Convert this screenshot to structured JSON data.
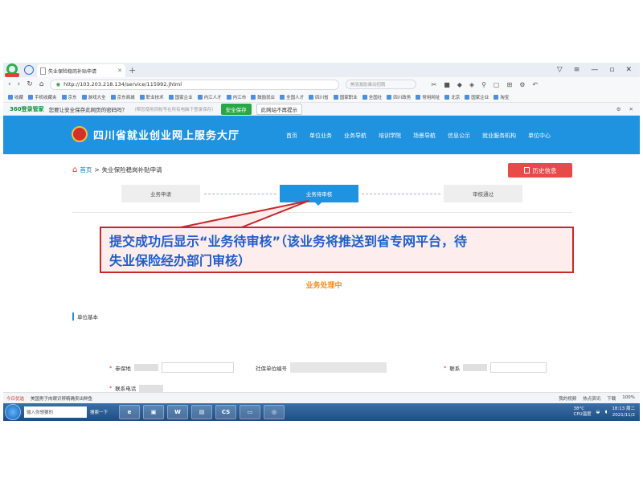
{
  "browser": {
    "tab_title": "失业保险稳岗补贴申请",
    "url": "http://103.203.218.134/service/115992.jhtml",
    "search_placeholder": "美丽激励乘动招聘",
    "bookmarks": [
      "收藏",
      "手机收藏夹",
      "京东",
      "游戏大全",
      "京东商城",
      "职业技术",
      "国家企业",
      "内江人才",
      "内江市",
      "鼓励就业",
      "全国人才",
      "四川省",
      "国家职业",
      "全国社",
      "四川政务",
      "常用网址",
      "北京",
      "国家企业",
      "淘宝"
    ]
  },
  "notice": {
    "brand": "360登录管家",
    "question": "您要让安全保存此网页的密码吗？",
    "hint": "（帮您使用同帐号在所有电脑下登录保存）",
    "save_label": "安全保存",
    "never_label": "此网站不再提示"
  },
  "site": {
    "title": "四川省就业创业网上服务大厅",
    "nav": [
      "首页",
      "单位业务",
      "业务导航",
      "培训学院",
      "场景导航",
      "信息公示",
      "就业服务机构",
      "单位中心"
    ]
  },
  "page": {
    "breadcrumb_home": "首页",
    "breadcrumb_sep": ">",
    "breadcrumb_current": "失业保险稳岗补贴申请",
    "history_button": "历史信息",
    "steps": [
      "业务申请",
      "业务待审核",
      "审核通过"
    ],
    "status_text": "业务处理中",
    "section_label": "单位基本",
    "fields": {
      "insured_label": "参保地",
      "unit_code_label": "社保单位编号",
      "contact_label": "联系",
      "phone_label": "联系电话"
    }
  },
  "callout": {
    "line1": "提交成功后显示“业务待审核”（该业务将推送到省专网平台，待",
    "line2": "失业保险经办部门审核）"
  },
  "statusbar": {
    "left": "今日优选",
    "news": "美国男子肉眼识辨精确卖出鲜鱼",
    "items": [
      "我的视频",
      "热点资讯",
      "下载"
    ],
    "zoom": "100%"
  },
  "taskbar": {
    "search_placeholder": "输入你想要的",
    "search_button": "搜索一下",
    "temp": "38°C",
    "temp_label": "CPU温度",
    "time": "18:13 周二",
    "date": "2021/11/2"
  }
}
